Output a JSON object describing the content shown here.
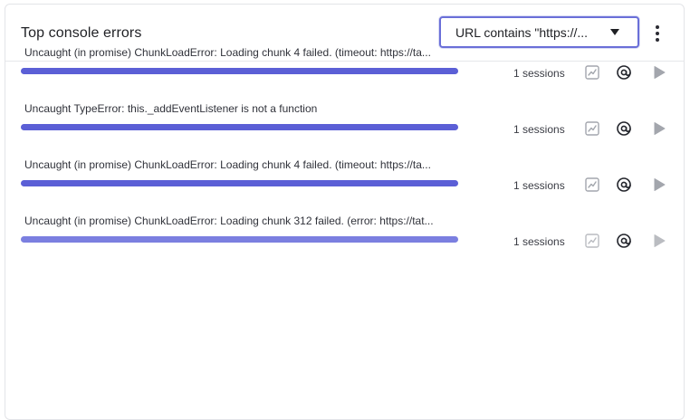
{
  "panel": {
    "title": "Top console errors",
    "filter": {
      "value": "URL contains \"https://..."
    }
  },
  "errors": [
    {
      "message": "Uncaught (in promise) ChunkLoadError: Loading chunk 4 failed. (timeout: https://ta...",
      "sessions_label": "1 sessions",
      "fraction": 1.0,
      "color": "#5b5fd6"
    },
    {
      "message": "Uncaught TypeError: this._addEventListener is not a function",
      "sessions_label": "1 sessions",
      "fraction": 1.0,
      "color": "#5b5fd6"
    },
    {
      "message": "Uncaught (in promise) ChunkLoadError: Loading chunk 4 failed. (timeout: https://ta...",
      "sessions_label": "1 sessions",
      "fraction": 1.0,
      "color": "#5b5fd6"
    },
    {
      "message": "Uncaught (in promise) ChunkLoadError: Loading chunk 312 failed. (error: https://tat...",
      "sessions_label": "1 sessions",
      "fraction": 1.0,
      "color": "#7b7fe0"
    }
  ],
  "icons": {
    "trend": "trend-chart-icon",
    "mention": "at-sign-icon",
    "play": "play-icon",
    "more": "more-vertical-icon",
    "caret": "caret-down-icon"
  }
}
